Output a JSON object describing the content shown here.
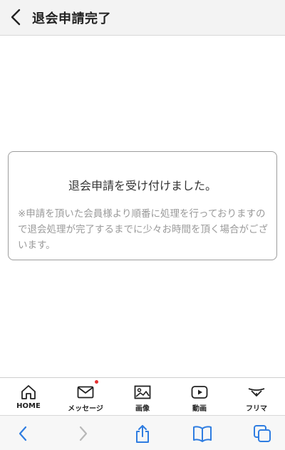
{
  "header": {
    "title": "退会申請完了",
    "back_icon": "chevron-left-icon"
  },
  "notice": {
    "main": "退会申請を受け付けました。",
    "sub": "※申請を頂いた会員様より順番に処理を行っておりますので退会処理が完了するまでに少々お時間を頂く場合がございます。"
  },
  "app_nav": {
    "items": [
      {
        "label": "HOME",
        "icon": "home-icon"
      },
      {
        "label": "メッセージ",
        "icon": "mail-icon",
        "badge": true
      },
      {
        "label": "画像",
        "icon": "image-icon"
      },
      {
        "label": "動画",
        "icon": "video-icon"
      },
      {
        "label": "フリマ",
        "icon": "flea-market-icon"
      }
    ]
  },
  "browser_toolbar": {
    "items": [
      "back-icon",
      "forward-icon",
      "share-icon",
      "bookmarks-icon",
      "tabs-icon"
    ]
  },
  "colors": {
    "accent": "#2f7de1",
    "badge": "#e53030",
    "muted_text": "#9a9a9a",
    "header_bg": "#f3f3f3"
  }
}
